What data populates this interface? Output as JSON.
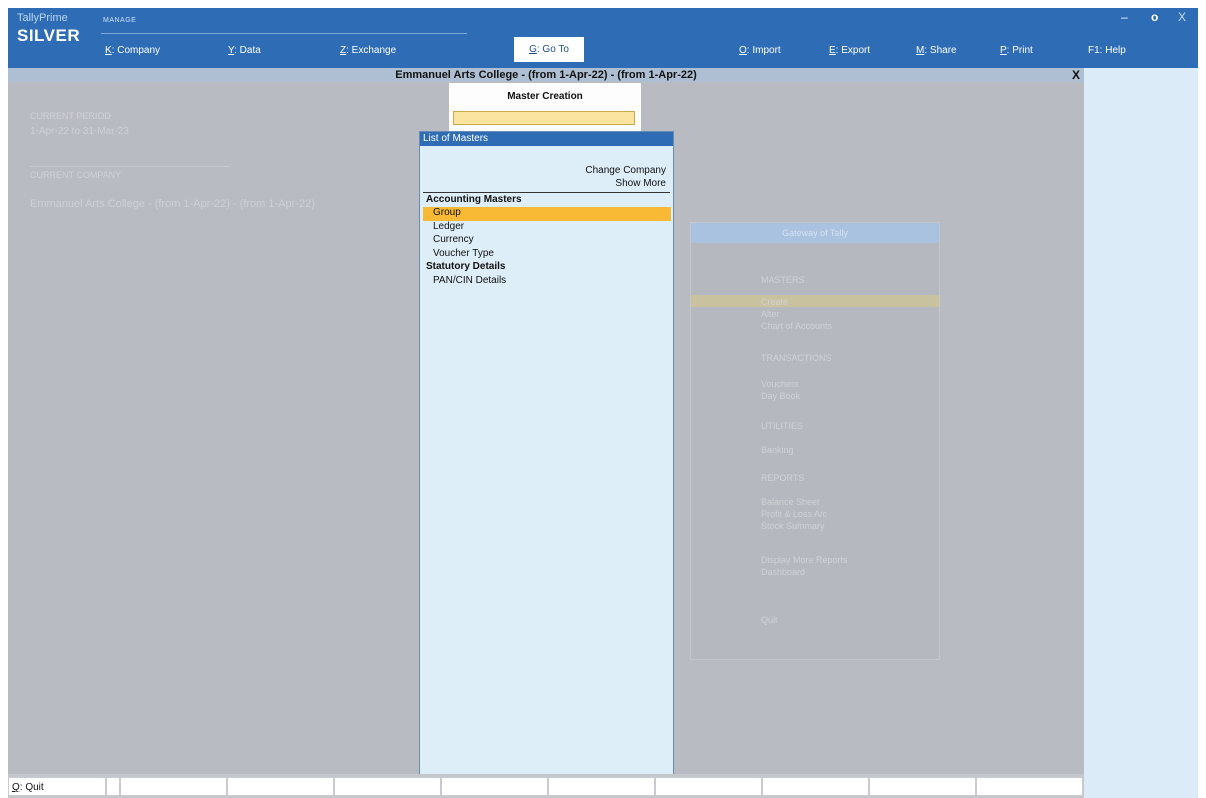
{
  "brand": {
    "product": "TallyPrime",
    "edition": "SILVER"
  },
  "gateway_label": "MANAGE",
  "menu": {
    "company": {
      "key": "K",
      "label": ": Company"
    },
    "data": {
      "key": "Y",
      "label": ": Data"
    },
    "exchange": {
      "key": "Z",
      "label": ": Exchange"
    },
    "goto": {
      "key": "G",
      "label": ": Go To"
    },
    "import": {
      "key": "O",
      "label": ": Import"
    },
    "export": {
      "key": "E",
      "label": ": Export"
    },
    "share": {
      "key": "M",
      "label": ": Share"
    },
    "print": {
      "key": "P",
      "label": ": Print"
    },
    "help": {
      "label": "F1: Help"
    }
  },
  "window_controls": {
    "minimize": "–",
    "restore": "o",
    "close": "X"
  },
  "title_bar": {
    "title": "Emmanuel  Arts  College - (from 1-Apr-22) - (from 1-Apr-22)",
    "close": "X"
  },
  "background": {
    "period_label": "CURRENT PERIOD",
    "period_value": "1-Apr-22 to 31-Mar-23",
    "company_label": "CURRENT COMPANY",
    "company_value": "Emmanuel  Arts  College - (from 1-Apr-22) - (from 1-Apr-22)",
    "gateway": {
      "title": "Gateway of Tally",
      "items": [
        "MASTERS",
        "Create",
        "Alter",
        "Chart of Accounts",
        "TRANSACTIONS",
        "Vouchers",
        "Day Book",
        "UTILITIES",
        "Banking",
        "REPORTS",
        "Balance Sheet",
        "Profit & Loss A/c",
        "Stock Summary",
        "Display More Reports",
        "Dashboard",
        "Quit"
      ]
    }
  },
  "master_creation": {
    "title": "Master Creation",
    "input_value": ""
  },
  "list_of_masters": {
    "title": "List of Masters",
    "links": [
      "Change Company",
      "Show More"
    ],
    "categories": {
      "accounting": {
        "label": "Accounting Masters",
        "items": [
          "Group",
          "Ledger",
          "Currency",
          "Voucher Type"
        ]
      },
      "statutory": {
        "label": "Statutory Details",
        "items": [
          "PAN/CIN Details"
        ]
      }
    },
    "selected": "Group"
  },
  "bottom_bar": {
    "quit_key": "Q",
    "quit_label": ": Quit"
  },
  "colors": {
    "accent_blue": "#2e6db5",
    "highlight": "#f8b934",
    "panel_light": "#deeef9",
    "backdrop": "#b8bcc2"
  }
}
